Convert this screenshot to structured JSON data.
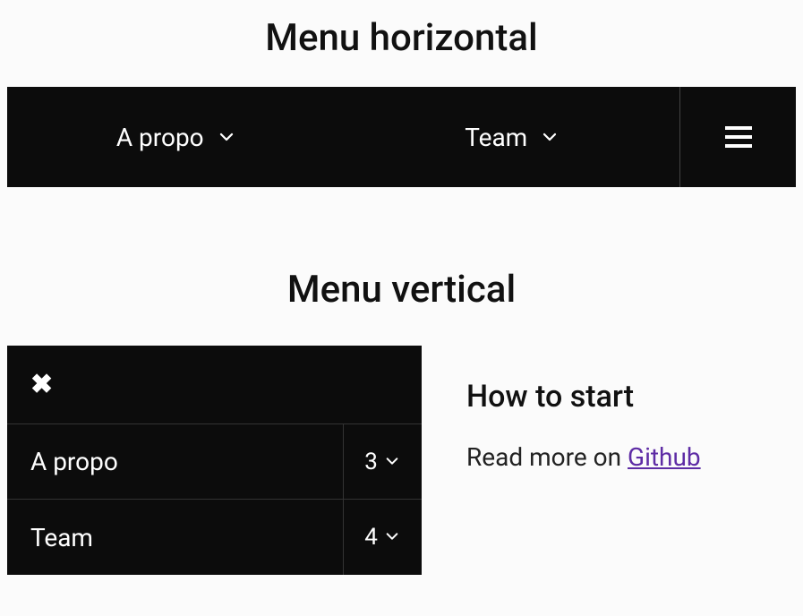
{
  "headings": {
    "horizontal": "Menu horizontal",
    "vertical": "Menu vertical"
  },
  "hmenu": {
    "items": [
      {
        "label": "A propo"
      },
      {
        "label": "Team"
      }
    ]
  },
  "vmenu": {
    "rows": [
      {
        "label": "A propo",
        "count": "3"
      },
      {
        "label": "Team",
        "count": "4"
      }
    ]
  },
  "side": {
    "heading": "How to start",
    "intro": "Read more on ",
    "link_label": "Github"
  }
}
